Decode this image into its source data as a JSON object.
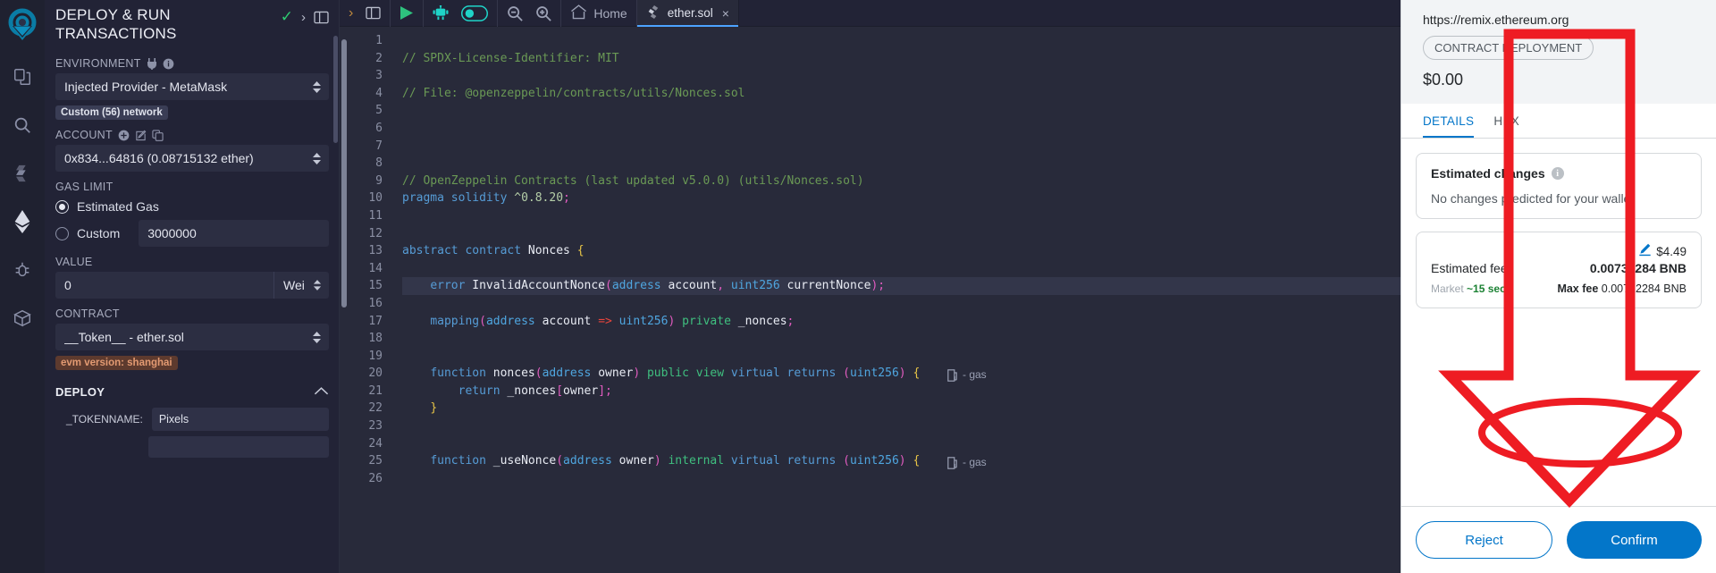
{
  "rail": {
    "icons": [
      {
        "name": "remix-logo",
        "label": "Remix"
      },
      {
        "name": "file-explorer-icon",
        "label": "File explorer"
      },
      {
        "name": "search-icon",
        "label": "Search in files"
      },
      {
        "name": "solidity-compiler-icon",
        "label": "Solidity compiler"
      },
      {
        "name": "deploy-run-icon",
        "label": "Deploy & run transactions"
      },
      {
        "name": "debugger-icon",
        "label": "Debugger"
      },
      {
        "name": "plugin-manager-icon",
        "label": "Plugin manager"
      }
    ]
  },
  "left_panel": {
    "title": "DEPLOY & RUN TRANSACTIONS",
    "environment_label": "ENVIRONMENT",
    "environment_value": "Injected Provider - MetaMask",
    "network_badge": "Custom (56) network",
    "account_label": "ACCOUNT",
    "account_value": "0x834...64816 (0.08715132 ether)",
    "gas_limit_label": "GAS LIMIT",
    "gas_estimated_label": "Estimated Gas",
    "gas_custom_label": "Custom",
    "gas_custom_value": "3000000",
    "value_label": "VALUE",
    "value_value": "0",
    "value_unit": "Wei",
    "contract_label": "CONTRACT",
    "contract_value": "__Token__ - ether.sol",
    "evm_badge": "evm version: shanghai",
    "deploy_label": "DEPLOY",
    "deploy_fields": [
      {
        "key": "_TOKENNAME:",
        "value": "Pixels"
      }
    ]
  },
  "editor": {
    "toolbar": {
      "run_label": "Run",
      "home_label": "Home"
    },
    "tab": {
      "label": "ether.sol",
      "close": "×"
    },
    "lines": [
      {
        "n": 1,
        "text": ""
      },
      {
        "n": 2,
        "text": "// SPDX-License-Identifier: MIT"
      },
      {
        "n": 3,
        "text": ""
      },
      {
        "n": 4,
        "text": "// File: @openzeppelin/contracts/utils/Nonces.sol"
      },
      {
        "n": 5,
        "text": ""
      },
      {
        "n": 6,
        "text": ""
      },
      {
        "n": 7,
        "text": ""
      },
      {
        "n": 8,
        "text": ""
      },
      {
        "n": 9,
        "text": "// OpenZeppelin Contracts (last updated v5.0.0) (utils/Nonces.sol)"
      },
      {
        "n": 10,
        "text": "pragma solidity ^0.8.20;"
      },
      {
        "n": 11,
        "text": ""
      },
      {
        "n": 12,
        "text": ""
      },
      {
        "n": 13,
        "text": "abstract contract Nonces {"
      },
      {
        "n": 14,
        "text": ""
      },
      {
        "n": 15,
        "text": "    error InvalidAccountNonce(address account, uint256 currentNonce);"
      },
      {
        "n": 16,
        "text": ""
      },
      {
        "n": 17,
        "text": "    mapping(address account => uint256) private _nonces;"
      },
      {
        "n": 18,
        "text": ""
      },
      {
        "n": 19,
        "text": ""
      },
      {
        "n": 20,
        "text": "    function nonces(address owner) public view virtual returns (uint256) {"
      },
      {
        "n": 21,
        "text": "        return _nonces[owner];"
      },
      {
        "n": 22,
        "text": "    }"
      },
      {
        "n": 23,
        "text": ""
      },
      {
        "n": 24,
        "text": ""
      },
      {
        "n": 25,
        "text": "    function _useNonce(address owner) internal virtual returns (uint256) {"
      },
      {
        "n": 26,
        "text": ""
      }
    ],
    "gas_hints": [
      {
        "line": 20,
        "text": "- gas"
      },
      {
        "line": 25,
        "text": "- gas"
      }
    ]
  },
  "metamask": {
    "origin": "https://remix.ethereum.org",
    "pill": "CONTRACT DEPLOYMENT",
    "amount": "$0.00",
    "tabs": [
      {
        "label": "DETAILS",
        "selected": true
      },
      {
        "label": "HEX",
        "selected": false
      }
    ],
    "estimated_changes": {
      "title": "Estimated changes",
      "body": "No changes predicted for your wallet"
    },
    "fee": {
      "usd": "$4.49",
      "label": "Estimated fee",
      "value": "0.00732284 BNB",
      "market_label": "Market",
      "market_time": "~15 sec",
      "max_fee_label": "Max fee",
      "max_fee_value": "0.00732284 BNB"
    },
    "buttons": {
      "reject": "Reject",
      "confirm": "Confirm"
    }
  },
  "annotation": {
    "color": "#ee1c23",
    "shapes": [
      "down-arrow",
      "ellipse-highlight"
    ]
  }
}
